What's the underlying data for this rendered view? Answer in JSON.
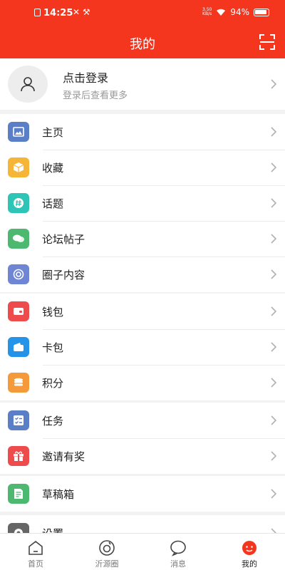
{
  "status_bar": {
    "time": "14:25",
    "speed": "3.50\nKB/s",
    "battery": "94%"
  },
  "header": {
    "title": "我的"
  },
  "profile": {
    "title": "点击登录",
    "subtitle": "登录后查看更多"
  },
  "groups": [
    [
      {
        "label": "主页",
        "icon": "image-icon",
        "color": "#5b7fc7"
      },
      {
        "label": "收藏",
        "icon": "box-icon",
        "color": "#f5b536"
      },
      {
        "label": "话题",
        "icon": "hashtag-icon",
        "color": "#2ec4b6"
      },
      {
        "label": "论坛帖子",
        "icon": "chat-bubbles-icon",
        "color": "#4cb870"
      },
      {
        "label": "圈子内容",
        "icon": "circle-swirl-icon",
        "color": "#6f86d4"
      }
    ],
    [
      {
        "label": "钱包",
        "icon": "wallet-icon",
        "color": "#ee4c4c"
      },
      {
        "label": "卡包",
        "icon": "card-icon",
        "color": "#2594e8"
      },
      {
        "label": "积分",
        "icon": "coins-icon",
        "color": "#f59a3b"
      }
    ],
    [
      {
        "label": "任务",
        "icon": "checklist-icon",
        "color": "#5b7fc7"
      },
      {
        "label": "邀请有奖",
        "icon": "gift-icon",
        "color": "#ee4c4c"
      }
    ],
    [
      {
        "label": "草稿箱",
        "icon": "draft-icon",
        "color": "#4cb870"
      }
    ],
    [
      {
        "label": "设置",
        "icon": "gear-icon",
        "color": "#666666"
      }
    ]
  ],
  "tabbar": [
    {
      "label": "首页",
      "icon": "home-icon",
      "active": false
    },
    {
      "label": "沂源圈",
      "icon": "circle-icon",
      "active": false
    },
    {
      "label": "消息",
      "icon": "message-icon",
      "active": false
    },
    {
      "label": "我的",
      "icon": "profile-face-icon",
      "active": true
    }
  ],
  "colors": {
    "brand": "#f4361f",
    "background": "#f2f2f2"
  }
}
